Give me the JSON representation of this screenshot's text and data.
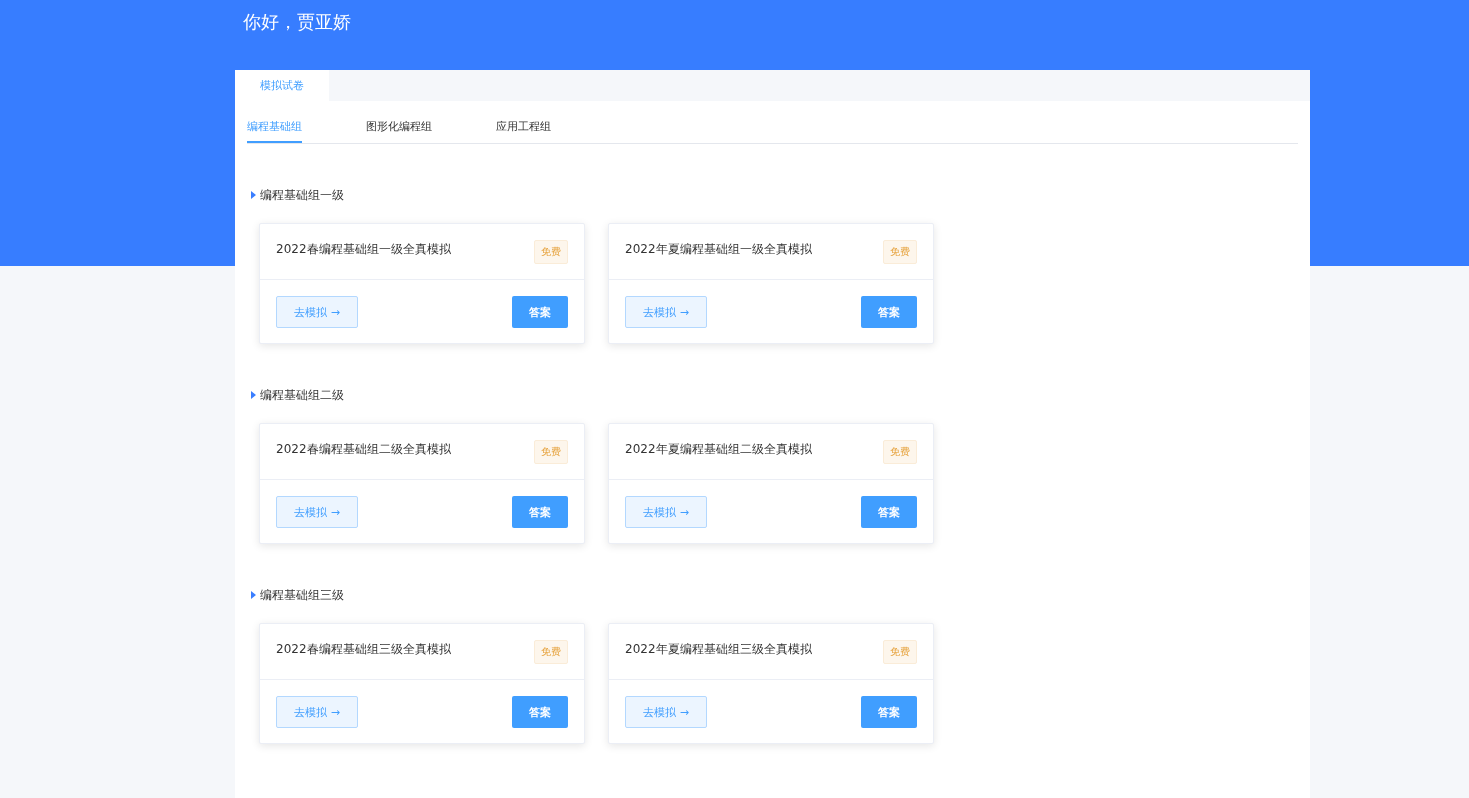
{
  "header": {
    "greeting": "你好，贾亚娇"
  },
  "tabs": [
    {
      "label": "模拟试卷",
      "selected": true
    }
  ],
  "subtabs": [
    {
      "label": "编程基础组",
      "selected": true
    },
    {
      "label": "图形化编程组",
      "selected": false
    },
    {
      "label": "应用工程组",
      "selected": false
    }
  ],
  "sections": [
    {
      "title": "编程基础组一级",
      "cards": [
        {
          "title": "2022春编程基础组一级全真模拟",
          "badge": "免费",
          "start": "去模拟 →",
          "answer": "答案"
        },
        {
          "title": "2022年夏编程基础组一级全真模拟",
          "badge": "免费",
          "start": "去模拟 →",
          "answer": "答案"
        }
      ]
    },
    {
      "title": "编程基础组二级",
      "cards": [
        {
          "title": "2022春编程基础组二级全真模拟",
          "badge": "免费",
          "start": "去模拟 →",
          "answer": "答案"
        },
        {
          "title": "2022年夏编程基础组二级全真模拟",
          "badge": "免费",
          "start": "去模拟 →",
          "answer": "答案"
        }
      ]
    },
    {
      "title": "编程基础组三级",
      "cards": [
        {
          "title": "2022春编程基础组三级全真模拟",
          "badge": "免费",
          "start": "去模拟 →",
          "answer": "答案"
        },
        {
          "title": "2022年夏编程基础组三级全真模拟",
          "badge": "免费",
          "start": "去模拟 →",
          "answer": "答案"
        }
      ]
    }
  ]
}
